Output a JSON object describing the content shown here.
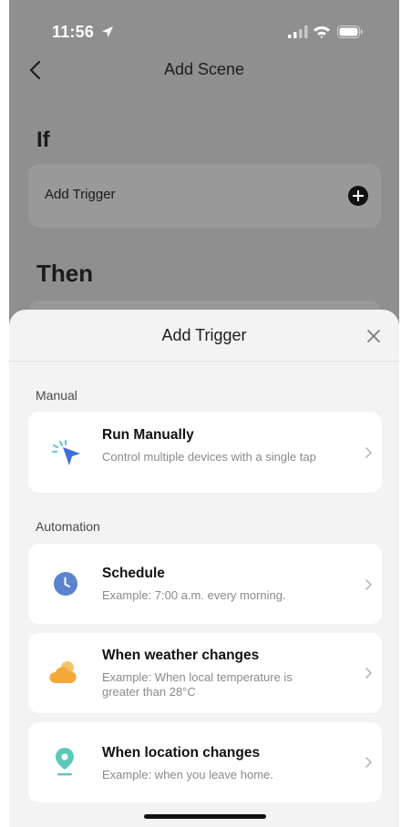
{
  "status_bar": {
    "time": "11:56",
    "icons": [
      "location-arrow-icon",
      "signal-icon",
      "wifi-icon",
      "battery-icon"
    ]
  },
  "nav": {
    "title": "Add Scene",
    "back_icon": "chevron-left-icon"
  },
  "if_section": {
    "heading": "If",
    "trigger_label": "Add Trigger",
    "add_icon": "plus-circle-icon"
  },
  "then_section": {
    "heading": "Then"
  },
  "sheet": {
    "title": "Add Trigger",
    "close_icon": "close-icon",
    "manual": {
      "label": "Manual",
      "items": [
        {
          "title": "Run Manually",
          "desc": "Control multiple devices with a single tap",
          "icon": "tap-cursor-icon"
        }
      ]
    },
    "automation": {
      "label": "Automation",
      "items": [
        {
          "title": "Schedule",
          "desc": "Example: 7:00 a.m. every morning.",
          "icon": "clock-icon"
        },
        {
          "title": "When weather changes",
          "desc": "Example: When local temperature is greater than 28°C",
          "icon": "weather-icon"
        },
        {
          "title": "When location changes",
          "desc": "Example: when you leave home.",
          "icon": "location-pin-icon"
        }
      ]
    }
  },
  "colors": {
    "overlay_bg": "#8f8f8f",
    "sheet_bg": "#f3f3f3",
    "card_bg": "#ffffff",
    "schedule_blue": "#5b84cf",
    "weather_orange": "#f4a83a",
    "location_teal": "#5cc8b8"
  }
}
